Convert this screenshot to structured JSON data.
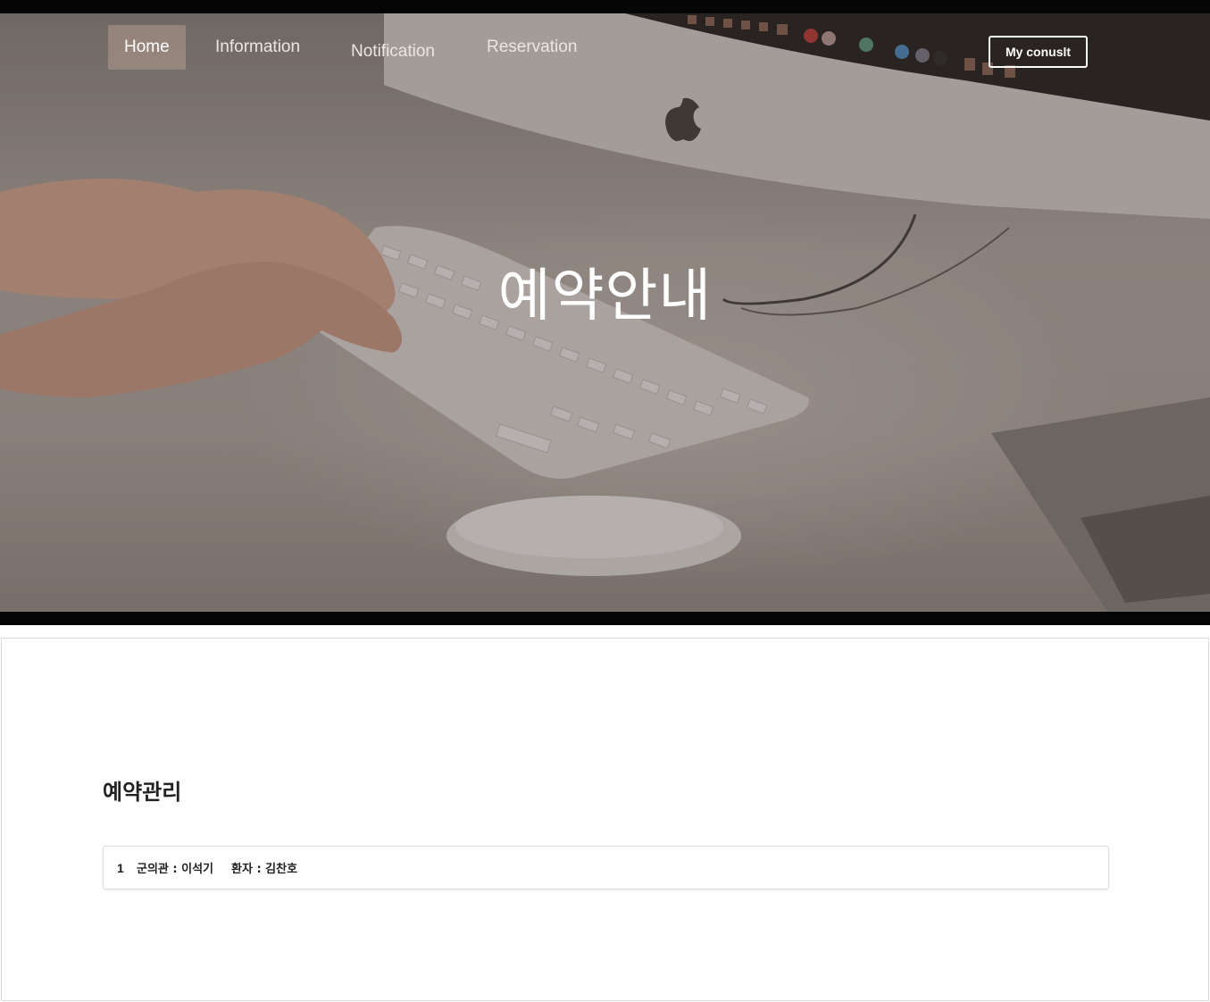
{
  "nav": {
    "items": [
      {
        "label": "Home",
        "active": true
      },
      {
        "label": "Information",
        "active": false
      },
      {
        "label": "Notification",
        "active": false
      },
      {
        "label": "Reservation",
        "active": false
      }
    ],
    "consult_button": "My conuslt"
  },
  "hero": {
    "title": "예약안내"
  },
  "section": {
    "title": "예약관리",
    "reservations": [
      {
        "num": "1",
        "doctor": "군의관 : 이석기",
        "patient": "환자 : 김찬호"
      }
    ]
  },
  "colors": {
    "hero_overlay": "#2c221e",
    "nav_active_bg": "#a98f82",
    "text_dark": "#222222"
  }
}
